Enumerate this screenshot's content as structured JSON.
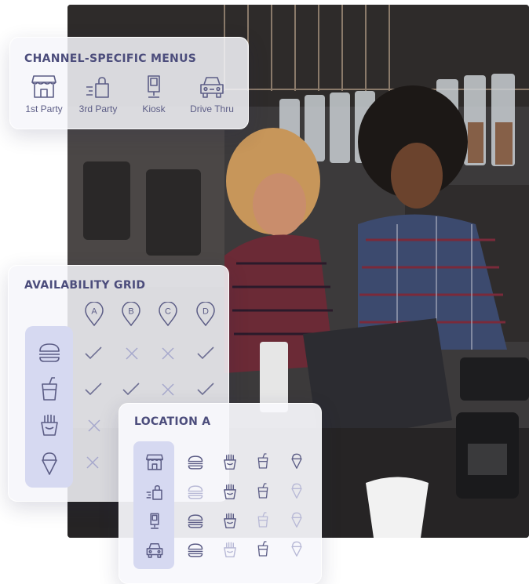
{
  "channels_card": {
    "title": "CHANNEL-SPECIFIC MENUS",
    "channels": [
      {
        "label": "1st Party",
        "icon": "storefront-icon"
      },
      {
        "label": "3rd Party",
        "icon": "delivery-bag-icon"
      },
      {
        "label": "Kiosk",
        "icon": "kiosk-icon"
      },
      {
        "label": "Drive Thru",
        "icon": "car-icon"
      }
    ]
  },
  "availability_card": {
    "title": "AVAILABILITY GRID",
    "locations": [
      "A",
      "B",
      "C",
      "D"
    ],
    "items": [
      {
        "icon": "burger-icon",
        "available": [
          true,
          false,
          false,
          true
        ]
      },
      {
        "icon": "drink-cup-icon",
        "available": [
          true,
          true,
          false,
          true
        ]
      },
      {
        "icon": "fries-icon",
        "available": [
          false
        ]
      },
      {
        "icon": "ice-cream-icon",
        "available": [
          false
        ]
      }
    ]
  },
  "location_card": {
    "title": "LOCATION A",
    "channel_icons": [
      "storefront-icon",
      "delivery-bag-icon",
      "kiosk-icon",
      "car-icon"
    ],
    "item_icons": [
      "burger-icon",
      "fries-icon",
      "drink-cup-icon",
      "ice-cream-icon"
    ],
    "availability": [
      [
        true,
        true,
        true,
        true
      ],
      [
        false,
        true,
        true,
        false
      ],
      [
        true,
        true,
        false,
        false
      ],
      [
        true,
        false,
        true,
        false
      ]
    ]
  },
  "colors": {
    "card_title": "#4c4d7c",
    "icon": "#5c5d86",
    "icon_faded": "#b8b9d6",
    "highlight_band": "#d6d9f1",
    "check": "#6f7094",
    "cross": "#a6a8cc"
  },
  "photo": {
    "icon": "cafe-photo-icon"
  }
}
